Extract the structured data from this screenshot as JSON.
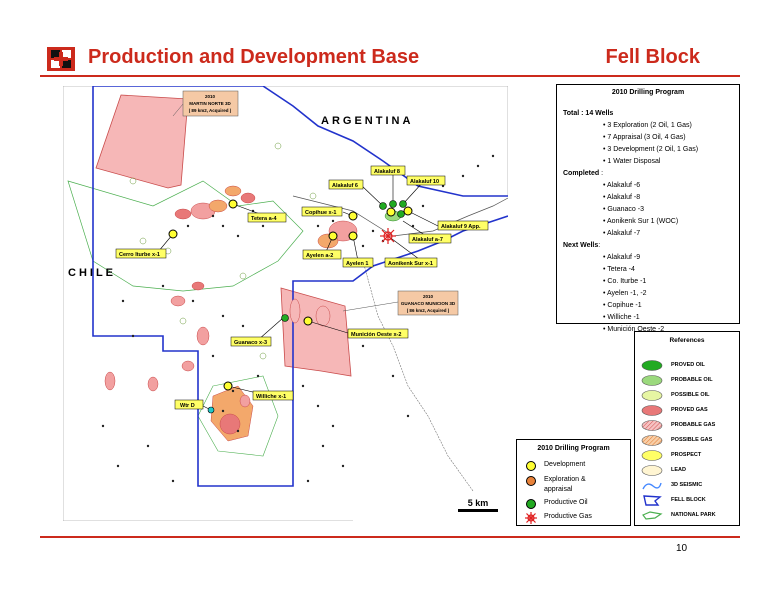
{
  "header": {
    "title": "Production and Development Base",
    "block": "Fell Block",
    "page_number": "10"
  },
  "map": {
    "countries": [
      "ARGENTINA",
      "CHILE"
    ],
    "scale": "5 km",
    "seismic_notes": [
      {
        "year": "2010",
        "name": "MARTIN NORTE 3D",
        "detail": "( 89 km2, Acquired )"
      },
      {
        "year": "2010",
        "name": "GUANACO MUNICION 3D",
        "detail": "( 86 km2, Acquired )"
      }
    ],
    "well_labels": [
      "Alakaluf 8",
      "Alakaluf 10",
      "Alakaluf 6",
      "Copihue x-1",
      "Tetera a-4",
      "Alakaluf 9 App.",
      "Alakaluf a-7",
      "Ayelen a-2",
      "Ayelen 1",
      "Aonikenk Sur x-1",
      "Cerro Iturbe x-1",
      "Munición Oeste x-2",
      "Guanaco x-3",
      "Williche x-1",
      "Wtr D"
    ]
  },
  "program": {
    "title": "2010 Drilling Program",
    "total": "Total : 14 Wells",
    "breakdown": [
      "• 3 Exploration (2 Oil, 1 Gas)",
      "• 7 Appraisal (3 Oil, 4 Gas)",
      "• 3 Development (2 Oil, 1 Gas)",
      "• 1 Water Disposal"
    ],
    "completed_label": "Completed",
    "completed_suffix": " :",
    "completed": [
      "• Alakaluf -6",
      "• Alakaluf -8",
      "• Guanaco -3",
      "• Aonikenk Sur 1 (WOC)",
      "• Alakaluf -7"
    ],
    "next_label": "Next Wells",
    "next_suffix": ":",
    "next": [
      "• Alakaluf -9",
      "• Tetera -4",
      "• Co. Iturbe -1",
      "• Ayelen -1, -2",
      "• Copihue -1",
      "• Williche -1",
      "• Munición Oeste -2"
    ]
  },
  "references": {
    "title": "References",
    "items": [
      "PROVED OIL",
      "PROBABLE OIL",
      "POSSIBLE OIL",
      "PROVED GAS",
      "PROBABLE GAS",
      "POSSIBLE GAS",
      "PROSPECT",
      "LEAD",
      "3D SEISMIC",
      "FELL BLOCK",
      "NATIONAL PARK"
    ]
  },
  "legend": {
    "title": "2010 Drilling Program",
    "items": [
      "Development",
      "Exploration & appraisal",
      "Productive Oil",
      "Productive Gas"
    ]
  },
  "colors": {
    "brand_red": "#cc2a1c",
    "block_outline": "#2233cc",
    "label_fill": "#ffff66",
    "seismic_fill": "#f6b7b7",
    "park_line": "#4caf50",
    "proved_oil": "#22aa22",
    "probable_oil": "#9bd97d",
    "possible_oil": "#e6f5a3",
    "proved_gas": "#e87878",
    "probable_gas": "#f2a0a0",
    "possible_gas": "#f3a86b",
    "prospect": "#ffff66",
    "lead": "#fff5d2"
  }
}
